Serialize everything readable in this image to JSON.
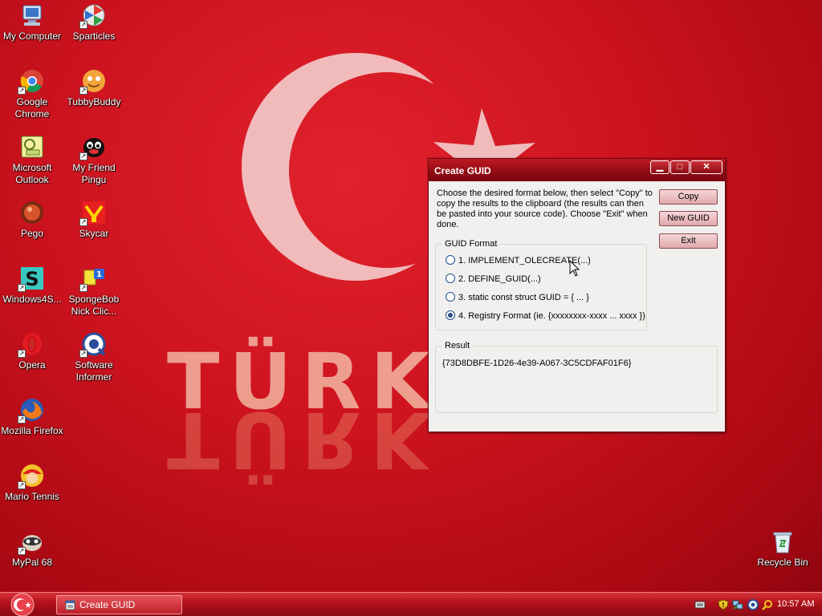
{
  "desktop": {
    "wallpaper_text": "TÜRK",
    "icons": [
      {
        "label": "My Computer",
        "icon": "computer-icon"
      },
      {
        "label": "Sparticles",
        "icon": "sparticles-icon"
      },
      {
        "label": "Google Chrome",
        "icon": "chrome-icon"
      },
      {
        "label": "TubbyBuddy",
        "icon": "tubbybuddy-icon"
      },
      {
        "label": "Microsoft Outlook",
        "icon": "outlook-icon"
      },
      {
        "label": "My Friend Pingu",
        "icon": "pingu-icon"
      },
      {
        "label": "Pego",
        "icon": "pego-icon"
      },
      {
        "label": "Skycar",
        "icon": "skycar-icon"
      },
      {
        "label": "Windows4S...",
        "icon": "windows4s-icon"
      },
      {
        "label": "SpongeBob Nick Clic...",
        "icon": "spongebob-icon"
      },
      {
        "label": "Opera",
        "icon": "opera-icon"
      },
      {
        "label": "Software Informer",
        "icon": "software-informer-icon"
      },
      {
        "label": "Mozilla Firefox",
        "icon": "firefox-icon"
      },
      {
        "label": "Mario Tennis",
        "icon": "mario-tennis-icon"
      },
      {
        "label": "MyPal 68",
        "icon": "mypal-icon"
      },
      {
        "label": "Recycle Bin",
        "icon": "recycle-bin-icon"
      }
    ]
  },
  "dialog": {
    "title": "Create GUID",
    "titlebar_buttons": {
      "minimize": "▁",
      "maximize": "□",
      "close": "✕"
    },
    "intro": "Choose the desired format below, then select \"Copy\" to copy the results to the clipboard (the results can then be pasted into your source code).  Choose \"Exit\" when done.",
    "buttons": {
      "copy": "Copy",
      "new_guid": "New GUID",
      "exit": "Exit"
    },
    "format_group": {
      "title": "GUID Format",
      "options": [
        {
          "label": "1. IMPLEMENT_OLECREATE(...)",
          "selected": false
        },
        {
          "label": "2. DEFINE_GUID(...)",
          "selected": false
        },
        {
          "label": "3. static const struct GUID = { ... }",
          "selected": false
        },
        {
          "label": "4. Registry Format (ie. {xxxxxxxx-xxxx ... xxxx })",
          "selected": true
        }
      ]
    },
    "result_group": {
      "title": "Result",
      "value": "{73D8DBFE-1D26-4e39-A067-3C5CDFAF01F6}"
    }
  },
  "taskbar": {
    "tasks": [
      {
        "label": "Create GUID"
      }
    ],
    "clock": "10:57 AM"
  },
  "colors": {
    "accent": "#c01822",
    "flag_red": "#e30a17",
    "dialog_bg": "#f2f0ee"
  }
}
